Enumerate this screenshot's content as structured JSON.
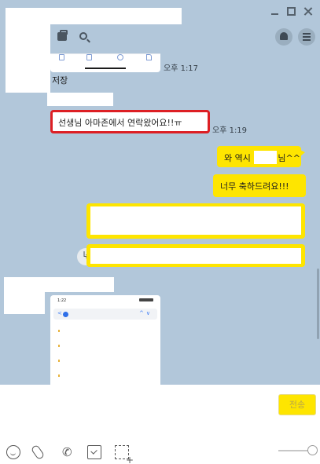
{
  "header": {
    "bag_icon": "bag-icon",
    "search_icon": "search-icon",
    "bell_icon": "bell-icon",
    "menu_icon": "menu-icon"
  },
  "messages": {
    "first_time": "오후 1:17",
    "save_text": "저장",
    "teacher_message": "선생님 아마존에서 연락왔어요!!ㅠ",
    "second_time": "오후 1:19",
    "wow_before": "와 역시",
    "wow_after": "님^^",
    "congrats": "너무 축하드려요!!!"
  },
  "phone_screenshot": {
    "status_time": "1:22"
  },
  "input": {
    "send_label": "전송"
  },
  "colors": {
    "chat_background": "#b2c7da",
    "my_bubble": "#fee500",
    "highlight_border": "#dd1f24"
  }
}
